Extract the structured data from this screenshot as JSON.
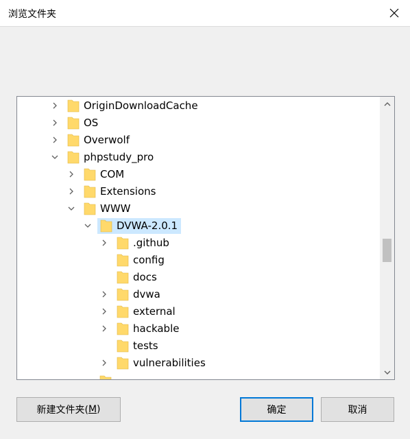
{
  "window": {
    "title": "浏览文件夹",
    "close_icon": "close-icon"
  },
  "tree": {
    "rows": [
      {
        "label": "OriginDownloadCache",
        "expander": "collapsed",
        "level": 0
      },
      {
        "label": "OS",
        "expander": "collapsed",
        "level": 0
      },
      {
        "label": "Overwolf",
        "expander": "collapsed",
        "level": 0
      },
      {
        "label": "phpstudy_pro",
        "expander": "expanded",
        "level": 0
      },
      {
        "label": "COM",
        "expander": "collapsed",
        "level": 1
      },
      {
        "label": "Extensions",
        "expander": "collapsed",
        "level": 1
      },
      {
        "label": "WWW",
        "expander": "expanded",
        "level": 1
      },
      {
        "label": "DVWA-2.0.1",
        "expander": "expanded",
        "level": 2,
        "selected": true
      },
      {
        "label": ".github",
        "expander": "collapsed",
        "level": 3
      },
      {
        "label": "config",
        "expander": "none",
        "level": 3
      },
      {
        "label": "docs",
        "expander": "none",
        "level": 3
      },
      {
        "label": "dvwa",
        "expander": "collapsed",
        "level": 3
      },
      {
        "label": "external",
        "expander": "collapsed",
        "level": 3
      },
      {
        "label": "hackable",
        "expander": "collapsed",
        "level": 3
      },
      {
        "label": "tests",
        "expander": "none",
        "level": 3
      },
      {
        "label": "vulnerabilities",
        "expander": "collapsed",
        "level": 3
      }
    ],
    "selection_color": "#cce8ff",
    "folder_color": "#ffd96b"
  },
  "buttons": {
    "new_folder_text": "新建文件夹(",
    "new_folder_accel": "M",
    "new_folder_close": ")",
    "ok": "确定",
    "cancel": "取消"
  },
  "colors": {
    "accent": "#0078d7",
    "background": "#f0f0f0"
  }
}
